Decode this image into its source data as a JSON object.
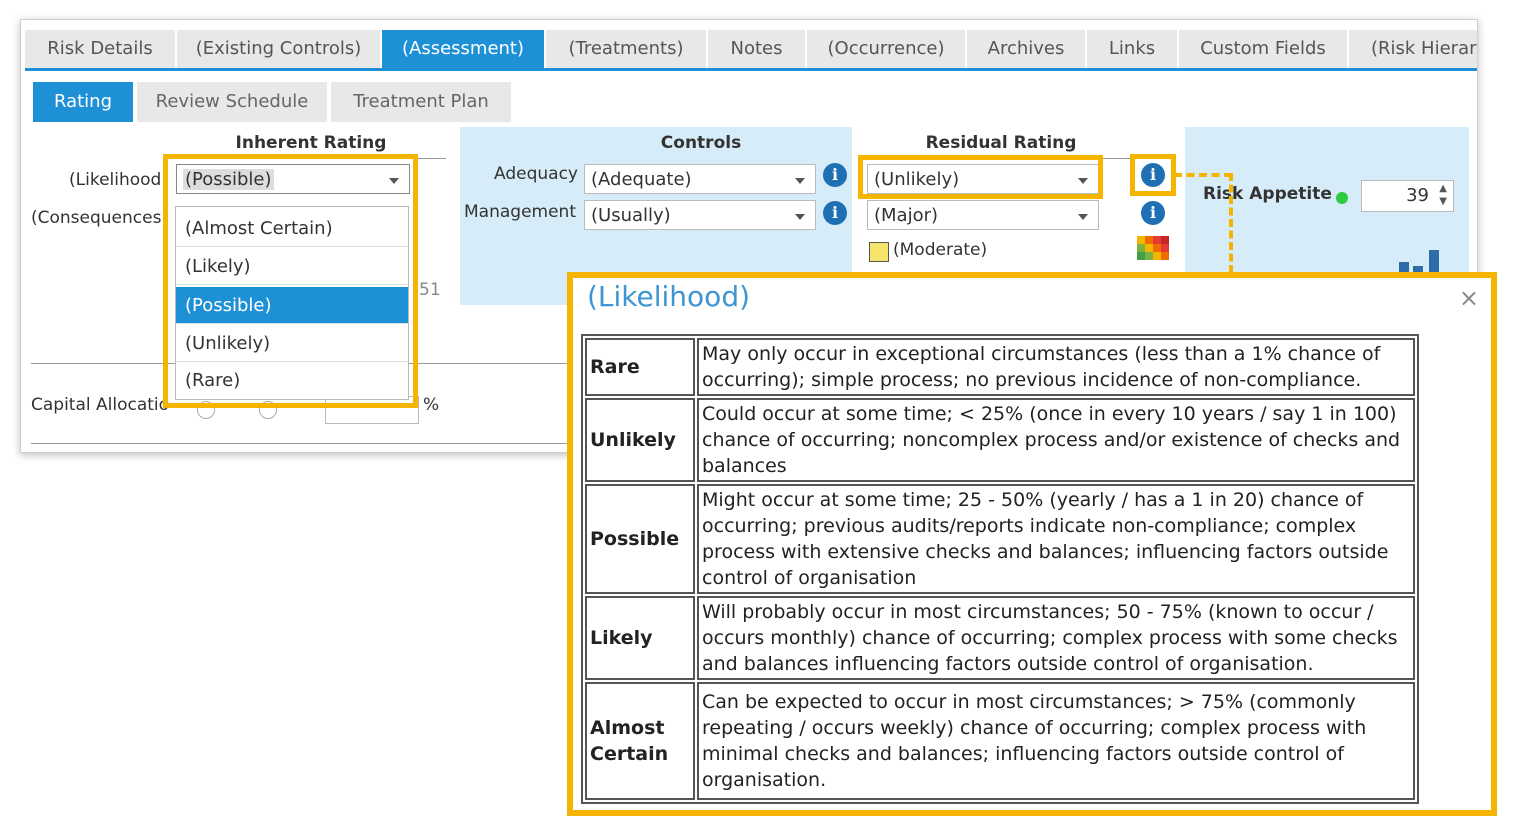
{
  "tabs": [
    "Risk Details",
    "(Existing Controls)",
    "(Assessment)",
    "(Treatments)",
    "Notes",
    "(Occurrence)",
    "Archives",
    "Links",
    "Custom Fields",
    "(Risk Hierarc"
  ],
  "subtabs": [
    "Rating",
    "Review Schedule",
    "Treatment Plan"
  ],
  "inherent": {
    "header": "Inherent Rating",
    "likelihood_label": "(Likelihood",
    "consequences_label": "(Consequences",
    "likelihood_value": "(Possible)",
    "score_fragment": "51",
    "options": [
      "(Almost Certain)",
      "(Likely)",
      "(Possible)",
      "(Unlikely)",
      "(Rare)"
    ],
    "selected_option": "(Possible)"
  },
  "controls": {
    "header": "Controls",
    "adequacy_label": "Adequacy",
    "adequacy_value": "(Adequate)",
    "management_label": "Management",
    "management_value": "(Usually)"
  },
  "residual": {
    "header": "Residual Rating",
    "likelihood_value": "(Unlikely)",
    "consequence_value": "(Major)",
    "rating_value": "(Moderate)",
    "rating_color": "#f5e36b"
  },
  "risk_appetite": {
    "label": "Risk Appetite",
    "value": "39",
    "status_color": "#2ecc40"
  },
  "capital": {
    "label": "Capital Allocatio",
    "percent_symbol": "%"
  },
  "popup": {
    "title": "(Likelihood)",
    "close": "×",
    "rows": [
      {
        "term": "Rare",
        "desc": "May only occur in exceptional circumstances (less than a 1% chance of occurring); simple process; no previous incidence of non-compliance."
      },
      {
        "term": "Unlikely",
        "desc": "Could occur at some time; < 25% (once in every 10 years / say 1 in 100) chance of occurring; noncomplex process and/or existence of checks and balances"
      },
      {
        "term": "Possible",
        "desc": "Might occur at some time; 25 - 50% (yearly / has a 1 in 20) chance of occurring; previous audits/reports indicate non-compliance; complex process with extensive checks and balances; influencing factors outside control of organisation"
      },
      {
        "term": "Likely",
        "desc": "Will probably occur in most circumstances; 50 - 75% (known to occur / occurs monthly) chance of occurring; complex process with some checks and balances influencing factors outside control of organisation."
      },
      {
        "term": "Almost Certain",
        "desc": "Can be expected to occur in most circumstances; > 75% (commonly repeating / occurs weekly) chance of occurring; complex process with minimal checks and balances; influencing factors outside control of organisation."
      }
    ]
  },
  "colors": {
    "accent": "#1e90d6",
    "highlight": "#f4b400",
    "info": "#1f6fb5"
  }
}
